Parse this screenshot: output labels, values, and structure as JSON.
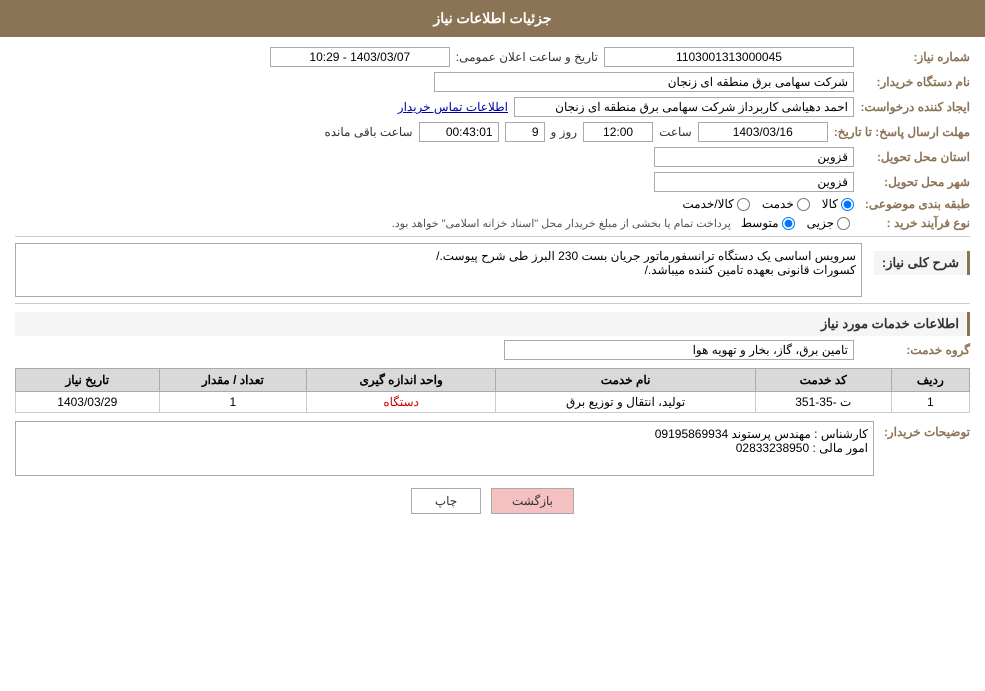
{
  "header": {
    "title": "جزئیات اطلاعات نیاز"
  },
  "form": {
    "need_number_label": "شماره نیاز:",
    "need_number_value": "1103001313000045",
    "announce_date_label": "تاریخ و ساعت اعلان عمومی:",
    "announce_date_value": "1403/03/07 - 10:29",
    "buyer_name_label": "نام دستگاه خریدار:",
    "buyer_name_value": "شرکت سهامی برق منطقه ای زنجان",
    "creator_label": "ایجاد کننده درخواست:",
    "creator_value": "احمد دهیاشی کاربرداز شرکت سهامی برق منطقه ای زنجان",
    "contact_link": "اطلاعات تماس خریدار",
    "reply_deadline_label": "مهلت ارسال پاسخ: تا تاریخ:",
    "reply_date_value": "1403/03/16",
    "reply_time_label": "ساعت",
    "reply_time_value": "12:00",
    "reply_days_label": "روز و",
    "reply_days_value": "9",
    "remaining_label": "ساعت باقی مانده",
    "remaining_value": "00:43:01",
    "province_label": "استان محل تحویل:",
    "province_value": "قزوین",
    "city_label": "شهر محل تحویل:",
    "city_value": "قزوین",
    "category_label": "طبقه بندی موضوعی:",
    "category_options": [
      {
        "id": "kala",
        "label": "کالا",
        "checked": true
      },
      {
        "id": "khedmat",
        "label": "خدمت",
        "checked": false
      },
      {
        "id": "kala_khedmat",
        "label": "کالا/خدمت",
        "checked": false
      }
    ],
    "purchase_type_label": "نوع فرآیند خرید :",
    "purchase_options": [
      {
        "id": "jozi",
        "label": "جزیی",
        "checked": false
      },
      {
        "id": "motawaset",
        "label": "متوسط",
        "checked": true
      }
    ],
    "purchase_note": "پرداخت تمام یا بخشی از مبلغ خریدار محل \"اسناد خزانه اسلامی\" خواهد بود.",
    "need_description_label": "شرح کلی نیاز:",
    "need_description": "سرویس اساسی یک دستگاه ترانسفورماتور جریان بست 230 البرز طی شرح پیوست./\nکسورات قانونی بعهده تامین کننده میباشد./",
    "services_section_label": "اطلاعات خدمات مورد نیاز",
    "service_group_label": "گروه خدمت:",
    "service_group_value": "تامین برق، گاز، بخار و تهویه هوا",
    "table": {
      "headers": [
        "ردیف",
        "کد خدمت",
        "نام خدمت",
        "واحد اندازه گیری",
        "تعداد / مقدار",
        "تاریخ نیاز"
      ],
      "rows": [
        {
          "row_num": "1",
          "service_code": "ت -35-351",
          "service_name": "تولید، انتقال و توزیع برق",
          "unit": "دستگاه",
          "unit_color": "red",
          "quantity": "1",
          "date": "1403/03/29"
        }
      ]
    },
    "buyer_desc_label": "توضیحات خریدار:",
    "buyer_desc_line1": "کارشناس : مهندس پرستوند 09195869934",
    "buyer_desc_line2": "امور مالی : 02833238950"
  },
  "buttons": {
    "print_label": "چاپ",
    "back_label": "بازگشت"
  }
}
